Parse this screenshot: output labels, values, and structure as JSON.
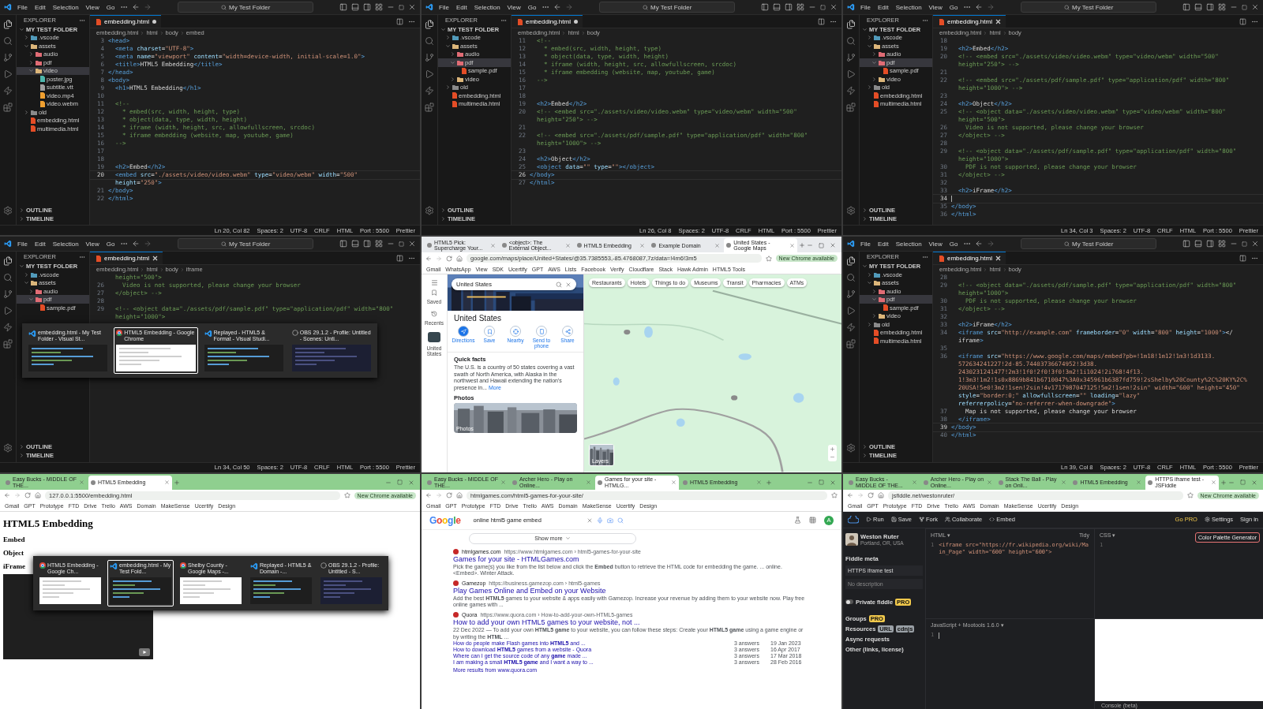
{
  "panels": [
    {
      "kind": "vscode",
      "menu": [
        "File",
        "Edit",
        "Selection",
        "View",
        "Go"
      ],
      "search": "My Test Folder",
      "explorer": "EXPLORER",
      "root": "MY TEST FOLDER",
      "tree": [
        {
          "name": ".vscode",
          "kind": "folder",
          "expanded": false,
          "selected": false,
          "color": "#519aba"
        },
        {
          "name": "assets",
          "kind": "folder",
          "expanded": true,
          "selected": false,
          "color": "#dcb67a",
          "children": [
            {
              "name": "audio",
              "kind": "folder",
              "expanded": false,
              "selected": false,
              "color": "#e06c75"
            },
            {
              "name": "pdf",
              "kind": "folder",
              "expanded": false,
              "selected": false,
              "color": "#e06c75"
            },
            {
              "name": "video",
              "kind": "folder",
              "expanded": true,
              "selected": true,
              "color": "#dcb67a",
              "children": [
                {
                  "name": "poster.jpg",
                  "kind": "file",
                  "selected": false,
                  "color": "#4db6ac"
                },
                {
                  "name": "subtitle.vtt",
                  "kind": "file",
                  "selected": false,
                  "color": "#9e9e9e"
                },
                {
                  "name": "video.mp4",
                  "kind": "file",
                  "selected": false,
                  "color": "#f0a030"
                },
                {
                  "name": "video.webm",
                  "kind": "file",
                  "selected": false,
                  "color": "#f0a030"
                }
              ]
            }
          ]
        },
        {
          "name": "old",
          "kind": "folder",
          "expanded": false,
          "selected": false,
          "color": "#8a8a8a"
        },
        {
          "name": "embedding.html",
          "kind": "file",
          "selected": false,
          "color": "#e44d26"
        },
        {
          "name": "multimedia.html",
          "kind": "file",
          "selected": false,
          "color": "#e44d26"
        }
      ],
      "tab": {
        "label": "embedding.html",
        "dirty": true
      },
      "breadcrumbs": [
        "embedding.html",
        "html",
        "body",
        "embed"
      ],
      "lines": [
        {
          "num": "3",
          "kind": "code",
          "text": "<head>"
        },
        {
          "num": "4",
          "kind": "code",
          "text": "  <meta charset=\"UTF-8\">"
        },
        {
          "num": "5",
          "kind": "code",
          "text": "  <meta name=\"viewport\" content=\"width=device-width, initial-scale=1.0\">"
        },
        {
          "num": "6",
          "kind": "code",
          "text": "  <title>HTML5 Embedding</title>"
        },
        {
          "num": "7",
          "kind": "code",
          "text": "</head>"
        },
        {
          "num": "8",
          "kind": "code",
          "text": "<body>"
        },
        {
          "num": "9",
          "kind": "code",
          "text": "  <h1>HTML5 Embedding</h1>"
        },
        {
          "num": "10"
        },
        {
          "num": "11",
          "kind": "comment",
          "text": "  <!--"
        },
        {
          "num": "12",
          "kind": "comment",
          "text": "    * embed(src, width, height, type)"
        },
        {
          "num": "13",
          "kind": "comment",
          "text": "    * object(data, type, width, height)"
        },
        {
          "num": "14",
          "kind": "comment",
          "text": "    * iframe (width, height, src, allowfullscreen, srcdoc)"
        },
        {
          "num": "15",
          "kind": "comment",
          "text": "    * iframe embedding (website, map, youtube, game)"
        },
        {
          "num": "16",
          "kind": "comment",
          "text": "  -->"
        },
        {
          "num": "17"
        },
        {
          "num": "18"
        },
        {
          "num": "19",
          "kind": "code",
          "text": "  <h2>Embed</h2>"
        },
        {
          "num": "20",
          "kind": "code",
          "text": "  <embed src=\"./assets/video/video.webm\" type=\"video/webm\" width=\"500\"",
          "current": true
        },
        {
          "kind": "code",
          "text": "  height=\"250\">"
        },
        {
          "num": "21",
          "kind": "code",
          "text": "</body>"
        },
        {
          "num": "22",
          "kind": "code",
          "text": "</html>"
        }
      ],
      "sections": [
        "OUTLINE",
        "TIMELINE"
      ],
      "status": [
        "Ln 20, Col 82",
        "Spaces: 2",
        "UTF-8",
        "CRLF",
        "HTML",
        "Port : 5500",
        "Prettier"
      ]
    },
    {
      "kind": "vscode",
      "menu": [
        "File",
        "Edit",
        "Selection",
        "View",
        "Go"
      ],
      "search": "My Test Folder",
      "explorer": "EXPLORER",
      "root": "MY TEST FOLDER",
      "tree": [
        {
          "name": ".vscode",
          "kind": "folder",
          "expanded": false,
          "selected": false,
          "color": "#519aba"
        },
        {
          "name": "assets",
          "kind": "folder",
          "expanded": true,
          "selected": false,
          "color": "#dcb67a",
          "children": [
            {
              "name": "audio",
              "kind": "folder",
              "expanded": false,
              "selected": false,
              "color": "#e06c75"
            },
            {
              "name": "pdf",
              "kind": "folder",
              "expanded": true,
              "selected": true,
              "color": "#e06c75",
              "children": [
                {
                  "name": "sample.pdf",
                  "kind": "file",
                  "selected": false,
                  "color": "#e44d26"
                }
              ]
            },
            {
              "name": "video",
              "kind": "folder",
              "expanded": false,
              "selected": false,
              "color": "#dcb67a"
            }
          ]
        },
        {
          "name": "old",
          "kind": "folder",
          "expanded": false,
          "selected": false,
          "color": "#8a8a8a"
        },
        {
          "name": "embedding.html",
          "kind": "file",
          "selected": false,
          "color": "#e44d26"
        },
        {
          "name": "multimedia.html",
          "kind": "file",
          "selected": false,
          "color": "#e44d26"
        }
      ],
      "tab": {
        "label": "embedding.html",
        "dirty": true
      },
      "breadcrumbs": [
        "embedding.html",
        "html",
        "body"
      ],
      "lines": [
        {
          "num": "11",
          "kind": "comment",
          "text": "  <!--"
        },
        {
          "num": "12",
          "kind": "comment",
          "text": "    * embed(src, width, height, type)"
        },
        {
          "num": "13",
          "kind": "comment",
          "text": "    * object(data, type, width, height)"
        },
        {
          "num": "14",
          "kind": "comment",
          "text": "    * iframe (width, height, src, allowfullscreen, srcdoc)"
        },
        {
          "num": "15",
          "kind": "comment",
          "text": "    * iframe embedding (website, map, youtube, game)"
        },
        {
          "num": "16",
          "kind": "comment",
          "text": "  -->"
        },
        {
          "num": "17"
        },
        {
          "num": "18"
        },
        {
          "num": "19",
          "kind": "code",
          "text": "  <h2>Embed</h2>"
        },
        {
          "num": "20",
          "kind": "comment",
          "text": "  <!-- <embed src=\"./assets/video/video.webm\" type=\"video/webm\" width=\"500\""
        },
        {
          "kind": "comment",
          "text": "  height=\"250\"> -->"
        },
        {
          "num": "21"
        },
        {
          "num": "22",
          "kind": "comment",
          "text": "  <!-- <embed src=\"./assets/pdf/sample.pdf\" type=\"application/pdf\" width=\"800\""
        },
        {
          "kind": "comment",
          "text": "  height=\"1000\"> -->"
        },
        {
          "num": "23"
        },
        {
          "num": "24",
          "kind": "code",
          "text": "  <h2>Object</h2>"
        },
        {
          "num": "25",
          "kind": "code",
          "text": "  <object data=\"\" type=\"\"></object>"
        },
        {
          "num": "26",
          "kind": "code",
          "text": "</body>",
          "current": true
        },
        {
          "num": "27",
          "kind": "code",
          "text": "</html>"
        }
      ],
      "sections": [
        "OUTLINE",
        "TIMELINE"
      ],
      "status": [
        "Ln 26, Col 8",
        "Spaces: 2",
        "UTF-8",
        "CRLF",
        "HTML",
        "Port : 5500",
        "Prettier"
      ]
    },
    {
      "kind": "vscode",
      "menu": [
        "File",
        "Edit",
        "Selection",
        "View",
        "Go"
      ],
      "search": "My Test Folder",
      "explorer": "EXPLORER",
      "root": "MY TEST FOLDER",
      "tree": [
        {
          "name": ".vscode",
          "kind": "folder",
          "expanded": false,
          "selected": false,
          "color": "#519aba"
        },
        {
          "name": "assets",
          "kind": "folder",
          "expanded": true,
          "selected": false,
          "color": "#dcb67a",
          "children": [
            {
              "name": "audio",
              "kind": "folder",
              "expanded": false,
              "selected": false,
              "color": "#e06c75"
            },
            {
              "name": "pdf",
              "kind": "folder",
              "expanded": true,
              "selected": true,
              "color": "#e06c75",
              "children": [
                {
                  "name": "sample.pdf",
                  "kind": "file",
                  "selected": false,
                  "color": "#e44d26"
                }
              ]
            },
            {
              "name": "video",
              "kind": "folder",
              "expanded": false,
              "selected": false,
              "color": "#dcb67a"
            }
          ]
        },
        {
          "name": "old",
          "kind": "folder",
          "expanded": false,
          "selected": false,
          "color": "#8a8a8a"
        },
        {
          "name": "embedding.html",
          "kind": "file",
          "selected": false,
          "color": "#e44d26"
        },
        {
          "name": "multimedia.html",
          "kind": "file",
          "selected": false,
          "color": "#e44d26"
        }
      ],
      "tab": {
        "label": "embedding.html",
        "dirty": false
      },
      "breadcrumbs": [
        "embedding.html",
        "html",
        "body"
      ],
      "lines": [
        {
          "num": "18"
        },
        {
          "num": "19",
          "kind": "code",
          "text": "  <h2>Embed</h2>"
        },
        {
          "num": "20",
          "kind": "comment",
          "text": "  <!-- <embed src=\"./assets/video/video.webm\" type=\"video/webm\" width=\"500\""
        },
        {
          "kind": "comment",
          "text": "  height=\"250\"> -->"
        },
        {
          "num": "21"
        },
        {
          "num": "22",
          "kind": "comment",
          "text": "  <!-- <embed src=\"./assets/pdf/sample.pdf\" type=\"application/pdf\" width=\"800\""
        },
        {
          "kind": "comment",
          "text": "  height=\"1000\"> -->"
        },
        {
          "num": "23"
        },
        {
          "num": "24",
          "kind": "code",
          "text": "  <h2>Object</h2>"
        },
        {
          "num": "25",
          "kind": "comment",
          "text": "  <!-- <object data=\"./assets/video/video.webm\" type=\"video/webm\" width=\"800\""
        },
        {
          "kind": "comment",
          "text": "  height=\"500\">"
        },
        {
          "num": "26",
          "kind": "comment",
          "text": "    Video is not supported, please change your browser"
        },
        {
          "num": "27",
          "kind": "comment",
          "text": "  </object> -->"
        },
        {
          "num": "28"
        },
        {
          "num": "29",
          "kind": "comment",
          "text": "  <!-- <object data=\"./assets/pdf/sample.pdf\" type=\"application/pdf\" width=\"800\""
        },
        {
          "kind": "comment",
          "text": "  height=\"1000\">"
        },
        {
          "num": "30",
          "kind": "comment",
          "text": "    PDF is not supported, please change your browser"
        },
        {
          "num": "31",
          "kind": "comment",
          "text": "  </object> -->"
        },
        {
          "num": "32"
        },
        {
          "num": "33",
          "kind": "code",
          "text": "  <h2>iFrame</h2>"
        },
        {
          "num": "34",
          "current": true
        },
        {
          "num": "35",
          "kind": "code",
          "text": "</body>"
        },
        {
          "num": "36",
          "kind": "code",
          "text": "</html>"
        }
      ],
      "sections": [
        "OUTLINE",
        "TIMELINE"
      ],
      "status": [
        "Ln 34, Col 3",
        "Spaces: 2",
        "UTF-8",
        "CRLF",
        "HTML",
        "Port : 5500",
        "Prettier"
      ]
    },
    {
      "kind": "vscode",
      "menu": [
        "File",
        "Edit",
        "Selection",
        "View",
        "Go"
      ],
      "search": "My Test Folder",
      "explorer": "EXPLORER",
      "root": "MY TEST FOLDER",
      "tree": [
        {
          "name": ".vscode",
          "kind": "folder",
          "expanded": false,
          "selected": false,
          "color": "#519aba"
        },
        {
          "name": "assets",
          "kind": "folder",
          "expanded": true,
          "selected": false,
          "color": "#dcb67a",
          "children": [
            {
              "name": "audio",
              "kind": "folder",
              "expanded": false,
              "selected": false,
              "color": "#e06c75"
            },
            {
              "name": "pdf",
              "kind": "folder",
              "expanded": true,
              "selected": true,
              "color": "#e06c75",
              "children": [
                {
                  "name": "sample.pdf",
                  "kind": "file",
                  "selected": false,
                  "color": "#e44d26"
                }
              ]
            }
          ]
        }
      ],
      "tab": {
        "label": "embedding.html",
        "dirty": false
      },
      "breadcrumbs": [
        "embedding.html",
        "html",
        "body",
        "iframe"
      ],
      "lines": [
        {
          "kind": "comment",
          "text": "  height=\"500\">"
        },
        {
          "num": "26",
          "kind": "comment",
          "text": "    Video is not supported, please change your browser"
        },
        {
          "num": "27",
          "kind": "comment",
          "text": "  </object> -->"
        },
        {
          "num": "28"
        },
        {
          "num": "29",
          "kind": "comment",
          "text": "  <!-- <object data=\"./assets/pdf/sample.pdf\" type=\"application/pdf\" width=\"800\""
        },
        {
          "kind": "comment",
          "text": "  height=\"1000\">"
        }
      ],
      "switcher": [
        {
          "title": "embedding.html - My Test Folder - Visual St...",
          "kind": "editor",
          "selected": false
        },
        {
          "title": "HTML5 Embedding - Google Chrome",
          "kind": "browser",
          "selected": true
        },
        {
          "title": "Replayed - HTML5 & Format - Visual Studi...",
          "kind": "editor",
          "selected": false
        },
        {
          "title": "OBS 29.1.2 - Profile: Untitled - Scenes: Unti...",
          "kind": "recorder",
          "selected": false
        }
      ],
      "sections": [
        "OUTLINE",
        "TIMELINE"
      ],
      "status": [
        "Ln 34, Col 50",
        "Spaces: 2",
        "UTF-8",
        "CRLF",
        "HTML",
        "Port : 5500",
        "Prettier"
      ]
    },
    {
      "kind": "browser",
      "tabs": [
        {
          "label": "HTML5 Pick: Supercharge Your...",
          "selected": false
        },
        {
          "label": "<object>: The External Object...",
          "selected": false
        },
        {
          "label": "HTML5 Embedding",
          "selected": false
        },
        {
          "label": "Example Domain",
          "selected": false
        },
        {
          "label": "United States - Google Maps",
          "selected": true
        }
      ],
      "url": "google.com/maps/place/United+States/@35.7385553,-85.4768087,7z/data=!4m6!3m5",
      "bookmarks": [
        "Gmail",
        "WhatsApp",
        "View",
        "SDK",
        "Ucertify",
        "GPT",
        "AWS",
        "Lists",
        "Facebook",
        "Verify",
        "Cloudflare",
        "Stack",
        "Hawk Admin",
        "HTML5 Tools"
      ],
      "update": "New Chrome available",
      "page": {
        "kind": "maps",
        "rail": [
          "Saved",
          "Recents",
          "United States"
        ],
        "search": "United States",
        "title": "United States",
        "actions": [
          "Directions",
          "Save",
          "Nearby",
          "Send to phone",
          "Share"
        ],
        "facts_title": "Quick facts",
        "facts": "The U.S. is a country of 50 states covering a vast swath of North America, with Alaska in the northwest and Hawaii extending the nation's presence in...",
        "more": "More",
        "photos_title": "Photos",
        "photo_label": "Photos",
        "layers_label": "Layers",
        "chips": [
          "Restaurants",
          "Hotels",
          "Things to do",
          "Museums",
          "Transit",
          "Pharmacies",
          "ATMs"
        ]
      }
    },
    {
      "kind": "vscode",
      "menu": [
        "File",
        "Edit",
        "Selection",
        "View",
        "Go"
      ],
      "search": "My Test Folder",
      "explorer": "EXPLORER",
      "root": "MY TEST FOLDER",
      "tree": [
        {
          "name": ".vscode",
          "kind": "folder",
          "expanded": false,
          "selected": false,
          "color": "#519aba"
        },
        {
          "name": "assets",
          "kind": "folder",
          "expanded": true,
          "selected": false,
          "color": "#dcb67a",
          "children": [
            {
              "name": "audio",
              "kind": "folder",
              "expanded": false,
              "selected": false,
              "color": "#e06c75"
            },
            {
              "name": "pdf",
              "kind": "folder",
              "expanded": true,
              "selected": true,
              "color": "#e06c75",
              "children": [
                {
                  "name": "sample.pdf",
                  "kind": "file",
                  "selected": false,
                  "color": "#e44d26"
                }
              ]
            },
            {
              "name": "video",
              "kind": "folder",
              "expanded": false,
              "selected": false,
              "color": "#dcb67a"
            }
          ]
        },
        {
          "name": "old",
          "kind": "folder",
          "expanded": false,
          "selected": false,
          "color": "#8a8a8a"
        },
        {
          "name": "embedding.html",
          "kind": "file",
          "selected": false,
          "color": "#e44d26"
        },
        {
          "name": "multimedia.html",
          "kind": "file",
          "selected": false,
          "color": "#e44d26"
        }
      ],
      "tab": {
        "label": "embedding.html",
        "dirty": false
      },
      "breadcrumbs": [
        "embedding.html",
        "html",
        "body"
      ],
      "lines": [
        {
          "num": "28"
        },
        {
          "num": "29",
          "kind": "comment",
          "text": "  <!-- <object data=\"./assets/pdf/sample.pdf\" type=\"application/pdf\" width=\"800\""
        },
        {
          "kind": "comment",
          "text": "  height=\"1000\">"
        },
        {
          "num": "30",
          "kind": "comment",
          "text": "    PDF is not supported, please change your browser"
        },
        {
          "num": "31",
          "kind": "comment",
          "text": "  </object> -->"
        },
        {
          "num": "32"
        },
        {
          "num": "33",
          "kind": "code",
          "text": "  <h2>iFrame</h2>"
        },
        {
          "num": "34",
          "kind": "code",
          "text": "  <iframe src=\"http://example.com\" frameborder=\"0\" width=\"800\" height=\"1000\"></"
        },
        {
          "kind": "code",
          "text": "  iframe>"
        },
        {
          "num": "35"
        },
        {
          "num": "36",
          "kind": "code",
          "text": "  <iframe src=\"https://www.google.com/maps/embed?pb=!1m18!1m12!1m3!1d3133."
        },
        {
          "kind": "string",
          "text": "  572634241227!2d-85.74403736674952!3d38."
        },
        {
          "kind": "string",
          "text": "  2430231241477!2m3!1f0!2f0!3f0!3m2!1i1024!2i768!4f13."
        },
        {
          "kind": "string",
          "text": "  1!3m3!1m2!1s0x8869b841b6710047%3A0x345961b6387fd759!2sShelby%20County%2C%20KY%2C%"
        },
        {
          "kind": "string",
          "text": "  20USA!5e0!3m2!1sen!2sin!4v1717987047125!5m2!1sen!2sin\" width=\"600\" height=\"450\""
        },
        {
          "kind": "code",
          "text": "  style=\"border:0;\" allowfullscreen=\"\" loading=\"lazy\""
        },
        {
          "kind": "code",
          "text": "  referrerpolicy=\"no-referrer-when-downgrade\">"
        },
        {
          "num": "37",
          "kind": "text",
          "text": "    Map is not supported, please change your browser"
        },
        {
          "num": "38",
          "kind": "code",
          "text": "  </iframe>"
        },
        {
          "num": "39",
          "kind": "code",
          "text": "</body>",
          "current": true
        },
        {
          "num": "40",
          "kind": "code",
          "text": "</html>"
        }
      ],
      "sections": [
        "OUTLINE",
        "TIMELINE"
      ],
      "status": [
        "Ln 39, Col 8",
        "Spaces: 2",
        "UTF-8",
        "CRLF",
        "HTML",
        "Port : 5500",
        "Prettier"
      ]
    },
    {
      "kind": "browser",
      "tabs": [
        {
          "label": "Easy Bucks - MIDDLE OF THE...",
          "selected": false
        },
        {
          "label": "HTML5 Embedding",
          "selected": true
        }
      ],
      "url": "127.0.0.1:5500/embedding.html",
      "bookmarks": [
        "Gmail",
        "GPT",
        "Prototype",
        "FTD",
        "Drive",
        "Trello",
        "AWS",
        "Domain",
        "MakeSense",
        "Ucertify",
        "Design"
      ],
      "update": "New Chrome available",
      "page": {
        "kind": "local",
        "h1": "HTML5 Embedding",
        "headings": [
          "Embed",
          "Object",
          "iFrame"
        ],
        "switcher": [
          {
            "title": "HTML5 Embedding - Google Ch...",
            "kind": "browser",
            "selected": false
          },
          {
            "title": "embedding.html - My Test Fold...",
            "kind": "editor",
            "selected": true
          },
          {
            "title": "Shelby County - Google Maps -...",
            "kind": "browser",
            "selected": false
          },
          {
            "title": "Replayed - HTML5 & Domain -...",
            "kind": "editor",
            "selected": false
          },
          {
            "title": "OBS 29.1.2 - Profile: Untitled - S...",
            "kind": "recorder",
            "selected": false
          }
        ]
      }
    },
    {
      "kind": "browser",
      "tabs": [
        {
          "label": "Easy Bucks - MIDDLE OF THE...",
          "selected": false
        },
        {
          "label": "Archer Hero - Play on Online...",
          "selected": false
        },
        {
          "label": "Games for your site - HTMLG...",
          "selected": true
        },
        {
          "label": "HTML5 Embedding",
          "selected": false
        }
      ],
      "url": "htmlgames.com/html5-games-for-your-site/",
      "bookmarks": [
        "Gmail",
        "GPT",
        "Prototype",
        "FTD",
        "Drive",
        "Trello",
        "AWS",
        "Domain",
        "MakeSense",
        "Ucertify",
        "Design"
      ],
      "page": {
        "kind": "google",
        "logo": "Google",
        "query": "online html5 game embed",
        "avatar": "A",
        "show_more": "Show more",
        "results": [
          {
            "site": "htmlgames.com",
            "path": "https://www.htmlgames.com › html5-games-for-your-site",
            "title": "Games for your site - HTMLGames.com",
            "snippet": "Pick the game(s) you like from the list below and click the **Embed** button to retrieve the HTML code for embedding the game. ... online. <Embed>. Winter Attack."
          },
          {
            "site": "Gamezop",
            "path": "https://business.gamezop.com › html5-games",
            "title": "Play Games Online and Embed on your Website",
            "snippet": "Add the best **HTML5** games to your website & apps easily with Gamezop. Increase your revenue by adding them to your website now. Play free online games with ..."
          },
          {
            "site": "Quora",
            "path": "https://www.quora.com › How-to-add-your-own-HTML5-games",
            "title": "How to add your own HTML5 games to your website, not ...",
            "snippet": "22 Dec 2022 — To add your own **HTML5 game** to your website, you can follow these steps: Create your **HTML5 game** using a game engine or by writing the **HTML** ...",
            "related": [
              {
                "question": "How do people make Flash games into **HTML5** and ...",
                "answers": "3 answers",
                "date": "19 Jan 2023"
              },
              {
                "question": "How to download **HTML5** games from a website - Quora",
                "answers": "3 answers",
                "date": "16 Apr 2017"
              },
              {
                "question": "Where can I get the source code of any **game** made ...",
                "answers": "3 answers",
                "date": "17 Mar 2018"
              },
              {
                "question": "I am making a small **HTML5 game** and I want a way to ...",
                "answers": "3 answers",
                "date": "28 Feb 2016"
              }
            ],
            "more": "More results from www.quora.com"
          }
        ]
      }
    },
    {
      "kind": "browser",
      "tabs": [
        {
          "label": "Easy Bucks - MIDDLE OF THE...",
          "selected": false
        },
        {
          "label": "Archer Hero - Play on Online...",
          "selected": false
        },
        {
          "label": "Stack The Ball - Play on Onli...",
          "selected": false
        },
        {
          "label": "HTML5 Embedding",
          "selected": false
        },
        {
          "label": "HTTPS iframe test - JSFiddle",
          "selected": true
        }
      ],
      "url": "jsfiddle.net/westonruter/",
      "bookmarks": [
        "Gmail",
        "GPT",
        "Prototype",
        "FTD",
        "Drive",
        "Trello",
        "AWS",
        "Domain",
        "MakeSense",
        "Ucertify",
        "Design"
      ],
      "update": "New Chrome available",
      "page": {
        "kind": "fiddle",
        "actions": [
          "Run",
          "Save",
          "Fork",
          "Collaborate",
          "Embed"
        ],
        "pro": "Go PRO",
        "settings": "Settings",
        "signin": "Sign in",
        "user": "Weston Ruter",
        "location": "Portland, OR, USA",
        "meta_title": "Fiddle meta",
        "fiddle_title": "HTTPS iframe test",
        "description": "No description",
        "private": {
          "label": "Private fiddle",
          "badge": "PRO",
          "on": false
        },
        "groups": {
          "label": "Groups",
          "badge": "PRO"
        },
        "resources": {
          "label": "Resources",
          "badges": [
            "URL",
            "cdnjs"
          ]
        },
        "async": "Async requests",
        "other": "Other (links, license)",
        "html_label": "HTML ▾",
        "tidy": "Tidy",
        "css_label": "CSS ▾",
        "palette": "Color Palette Generator",
        "js_label": "JavaScript + Mootools 1.6.0 ▾",
        "html_code": "<iframe src=\"https://fr.wikipedia.org/wiki/Main_Page\" width=\"600\" height=\"600\">",
        "html_num": "1",
        "js_num": "1",
        "css_num": "1",
        "console": "Console (beta)"
      }
    }
  ]
}
